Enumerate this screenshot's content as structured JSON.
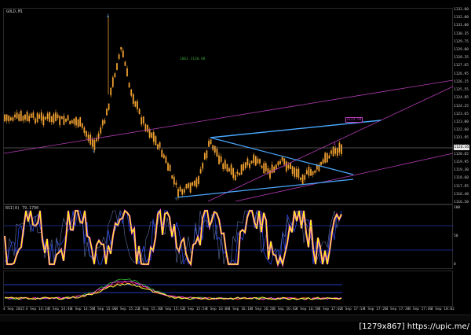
{
  "chart": {
    "symbol_label": "GOLD,M1",
    "rsi_label": "RSI(8) 79.1790",
    "fib_label": "2062 1130.08",
    "current_price": "1120.65",
    "level_price": "1123.59",
    "price_ticks": [
      "1133.00",
      "1132.00",
      "1131.00",
      "1130.35",
      "1129.75",
      "1129.00",
      "1128.35",
      "1127.65",
      "1126.95",
      "1126.25",
      "1125.55",
      "1124.85",
      "1124.25",
      "1123.65",
      "1123.00",
      "1122.60",
      "1121.95",
      "1121.30",
      "1120.65",
      "1119.95",
      "1119.30",
      "1118.60",
      "1117.95",
      "1116.40",
      "1116.50"
    ],
    "rsi_ticks": [
      "100",
      "50",
      "0"
    ],
    "time_ticks": [
      "4 Sep 2015",
      "4 Sep 14:34",
      "4 Sep 14:46",
      "4 Sep 14:58",
      "4 Sep 15:06",
      "4 Sep 15:22",
      "4 Sep 15:30",
      "4 Sep 15:42",
      "4 Sep 15:54",
      "4 Sep 16:06",
      "4 Sep 16:18",
      "4 Sep 16:26",
      "4 Sep 16:42",
      "4 Sep 16:50",
      "4 Sep 17:02",
      "4 Sep 17:14",
      "4 Sep 17:26",
      "4 Sep 17:38",
      "4 Sep 17:46",
      "4 Sep 18:02"
    ],
    "colors": {
      "background": "#000000",
      "candles": "#f0a030",
      "trend_blue": "#4aa8ff",
      "channel_magenta": "#b43cb4",
      "rsi_main": "#ffff00",
      "rsi_shadow": "#ff40ff",
      "rsi_blue": "#3050ff",
      "macd_green": "#30c030",
      "macd_yellow": "#ffff40",
      "macd_red": "#ff3030"
    }
  },
  "footer": {
    "watermark": "[1279x867] https://upic.me/"
  }
}
